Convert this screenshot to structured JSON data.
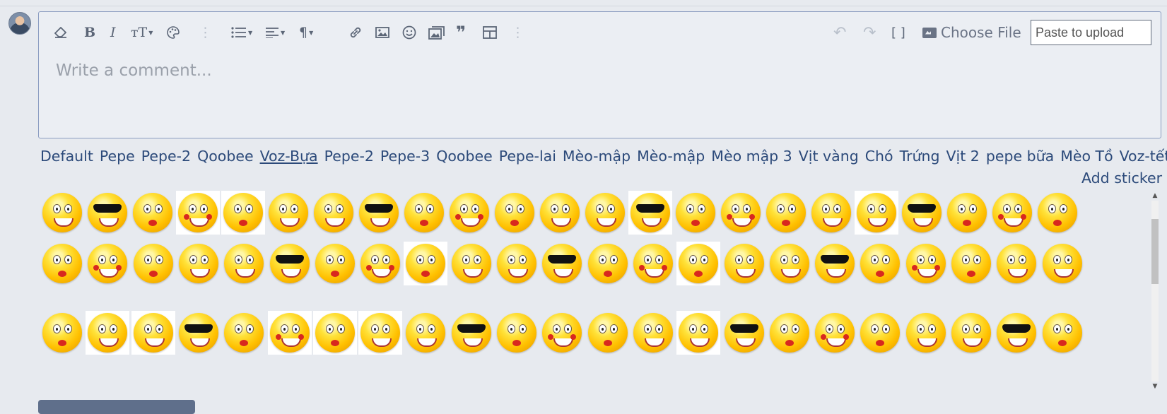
{
  "editor": {
    "placeholder": "Write a comment...",
    "choose_file_label": "Choose File",
    "paste_placeholder": "Paste to upload"
  },
  "toolbar": {
    "items": [
      {
        "name": "clear-formatting",
        "icon": "eraser-icon",
        "glyph": "⌫"
      },
      {
        "name": "bold",
        "icon": "bold-icon",
        "glyph": "B"
      },
      {
        "name": "italic",
        "icon": "italic-icon",
        "glyph": "I"
      },
      {
        "name": "font-size",
        "icon": "text-size-icon",
        "glyph": "тT"
      },
      {
        "name": "text-color",
        "icon": "palette-icon",
        "glyph": "🎨"
      },
      {
        "name": "more-text",
        "icon": "more-vertical-icon",
        "glyph": "⋮"
      },
      {
        "name": "list",
        "icon": "list-icon",
        "glyph": "☰"
      },
      {
        "name": "align",
        "icon": "align-icon",
        "glyph": "≡"
      },
      {
        "name": "paragraph",
        "icon": "paragraph-icon",
        "glyph": "¶"
      },
      {
        "name": "link",
        "icon": "link-icon",
        "glyph": "🔗"
      },
      {
        "name": "image",
        "icon": "image-icon",
        "glyph": "🖼"
      },
      {
        "name": "emoji",
        "icon": "smiley-icon",
        "glyph": "☺"
      },
      {
        "name": "media",
        "icon": "media-gallery-icon",
        "glyph": "▣"
      },
      {
        "name": "quote",
        "icon": "quote-icon",
        "glyph": "❞"
      },
      {
        "name": "table",
        "icon": "table-icon",
        "glyph": "⊞"
      },
      {
        "name": "more-insert",
        "icon": "more-vertical-icon",
        "glyph": "⋮"
      },
      {
        "name": "undo",
        "icon": "undo-icon",
        "glyph": "↶"
      },
      {
        "name": "redo",
        "icon": "redo-icon",
        "glyph": "↷"
      },
      {
        "name": "bbcode",
        "icon": "brackets-icon",
        "glyph": "[ ]"
      }
    ]
  },
  "sticker_tabs": [
    "Default",
    "Pepe",
    "Pepe-2",
    "Qoobee",
    "Voz-Bựa",
    "Pepe-2",
    "Pepe-3",
    "Qoobee",
    "Pepe-lai",
    "Mèo-mập",
    "Mèo-mập",
    "Mèo mập 3",
    "Vịt vàng",
    "Chó",
    "Trứng",
    "Vịt 2",
    "pepe bữa",
    "Mèo Tồ",
    "Voz-tết"
  ],
  "active_tab": "Voz-Bựa",
  "add_sticker_label": "Add sticker",
  "colors": {
    "link": "#2c4a7a",
    "editor_border": "#8a9bc0",
    "emoticon_yellow": "#ffc000"
  },
  "emoticon_icon": "yellow-smiley-face-sticker"
}
